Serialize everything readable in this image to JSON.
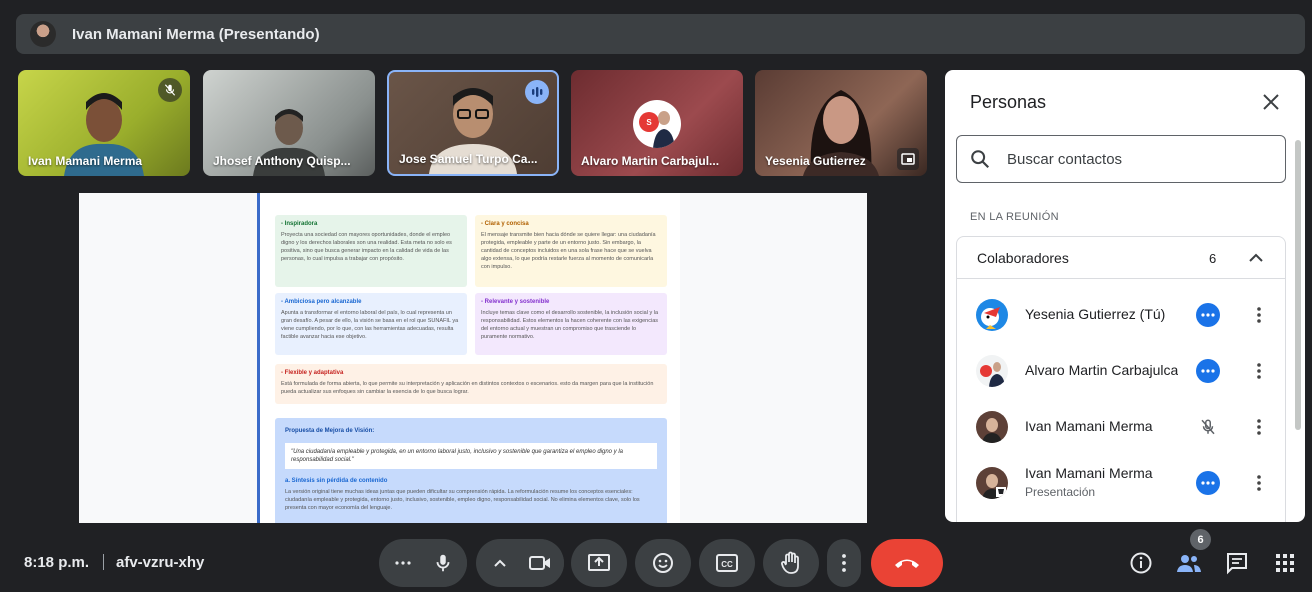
{
  "presenting_bar": {
    "title": "Ivan Mamani Merma (Presentando)"
  },
  "tiles": [
    {
      "name": "Ivan Mamani Merma",
      "status": "mic-off-icon"
    },
    {
      "name": "Jhosef Anthony Quisp..."
    },
    {
      "name": "Jose Samuel Turpo Ca...",
      "status": "speaking-icon"
    },
    {
      "name": "Alvaro Martin Carbajul..."
    },
    {
      "name": "Yesenia Gutierrez",
      "status": "pip-icon"
    }
  ],
  "slide": {
    "boxes": [
      {
        "heading": "- Inspiradora",
        "body": "Proyecta una sociedad con mayores oportunidades, donde el empleo digno y los derechos laborales son una realidad. Esta meta no solo es positiva, sino que busca generar impacto en la calidad de vida de las personas, lo cual impulsa a trabajar con propósito."
      },
      {
        "heading": "- Clara y concisa",
        "body": "El mensaje transmite bien hacia dónde se quiere llegar: una ciudadanía protegida, empleable y parte de un entorno justo. Sin embargo, la cantidad de conceptos incluidos en una sola frase hace que se vuelva algo extensa, lo que podría restarle fuerza al momento de comunicarla con impulso."
      },
      {
        "heading": "- Ambiciosa pero alcanzable",
        "body": "Apunta a transformar el entorno laboral del país, lo cual representa un gran desafío. A pesar de ello, la visión se basa en el rol que SUNAFIL ya viene cumpliendo, por lo que, con las herramientas adecuadas, resulta factible avanzar hacia ese objetivo."
      },
      {
        "heading": "- Relevante y sostenible",
        "body": "Incluye temas clave como el desarrollo sostenible, la inclusión social y la responsabilidad. Estos elementos la hacen coherente con las exigencias del entorno actual y muestran un compromiso que trasciende lo puramente normativo."
      },
      {
        "heading": "- Flexible y adaptativa",
        "body": "Está formulada de forma abierta, lo que permite su interpretación y aplicación en distintos contextos o escenarios. esto da margen para que la institución pueda actualizar sus enfoques sin cambiar la esencia de lo que busca lograr."
      }
    ],
    "proposal": {
      "heading": "Propuesta de Mejora de Visión:",
      "quote": "\"Una ciudadanía empleable y protegida, en un entorno laboral justo, inclusivo y sostenible que garantiza el empleo digno y la responsabilidad social.\"",
      "subheading": "a. Síntesis sin pérdida de contenido",
      "body": "La versión original tiene muchas ideas juntas que pueden dificultar su comprensión rápida. La reformulación resume los conceptos esenciales: ciudadanía empleable y protegida, entorno justo, inclusivo, sostenible, empleo digno, responsabilidad social. No elimina elementos clave, solo los presenta con mayor economía del lenguaje."
    }
  },
  "panel": {
    "title": "Personas",
    "search_placeholder": "Buscar contactos",
    "section_label": "EN LA REUNIÓN",
    "group_label": "Colaboradores",
    "group_count": "6",
    "people": [
      {
        "name": "Yesenia Gutierrez (Tú)",
        "subtitle": "",
        "status": "audio-dots-icon"
      },
      {
        "name": "Alvaro Martin Carbajulca",
        "subtitle": "",
        "status": "audio-dots-icon"
      },
      {
        "name": "Ivan Mamani Merma",
        "subtitle": "",
        "status": "mic-off-icon"
      },
      {
        "name": "Ivan Mamani Merma",
        "subtitle": "Presentación",
        "status": "audio-dots-icon"
      }
    ]
  },
  "bottom_bar": {
    "time": "8:18 p.m.",
    "meeting_code": "afv-vzru-xhy",
    "people_badge": "6"
  },
  "colors": {
    "accent": "#1a73e8",
    "end_call": "#ea4335",
    "bar": "#3c4043",
    "background": "#202124"
  }
}
